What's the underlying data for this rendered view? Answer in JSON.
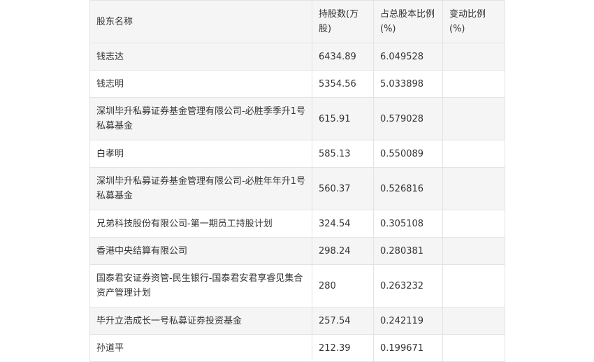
{
  "table": {
    "headers": [
      "股东名称",
      "持股数(万股)",
      "占总股本比例(%)",
      "变动比例(%)"
    ],
    "rows": [
      {
        "name": "钱志达",
        "shares": "6434.89",
        "ratio": "6.049528",
        "change": ""
      },
      {
        "name": "钱志明",
        "shares": "5354.56",
        "ratio": "5.033898",
        "change": ""
      },
      {
        "name": "深圳毕升私募证券基金管理有限公司-必胜季季升1号私募基金",
        "shares": "615.91",
        "ratio": "0.579028",
        "change": ""
      },
      {
        "name": "白孝明",
        "shares": "585.13",
        "ratio": "0.550089",
        "change": ""
      },
      {
        "name": "深圳毕升私募证券基金管理有限公司-必胜年年升1号私募基金",
        "shares": "560.37",
        "ratio": "0.526816",
        "change": ""
      },
      {
        "name": "兄弟科技股份有限公司-第一期员工持股计划",
        "shares": "324.54",
        "ratio": "0.305108",
        "change": ""
      },
      {
        "name": "香港中央结算有限公司",
        "shares": "298.24",
        "ratio": "0.280381",
        "change": ""
      },
      {
        "name": "国泰君安证券资管-民生银行-国泰君安君享睿见集合资产管理计划",
        "shares": "280",
        "ratio": "0.263232",
        "change": ""
      },
      {
        "name": "毕升立浩成长一号私募证券投资基金",
        "shares": "257.54",
        "ratio": "0.242119",
        "change": ""
      },
      {
        "name": "孙道平",
        "shares": "212.39",
        "ratio": "0.199671",
        "change": ""
      }
    ]
  }
}
